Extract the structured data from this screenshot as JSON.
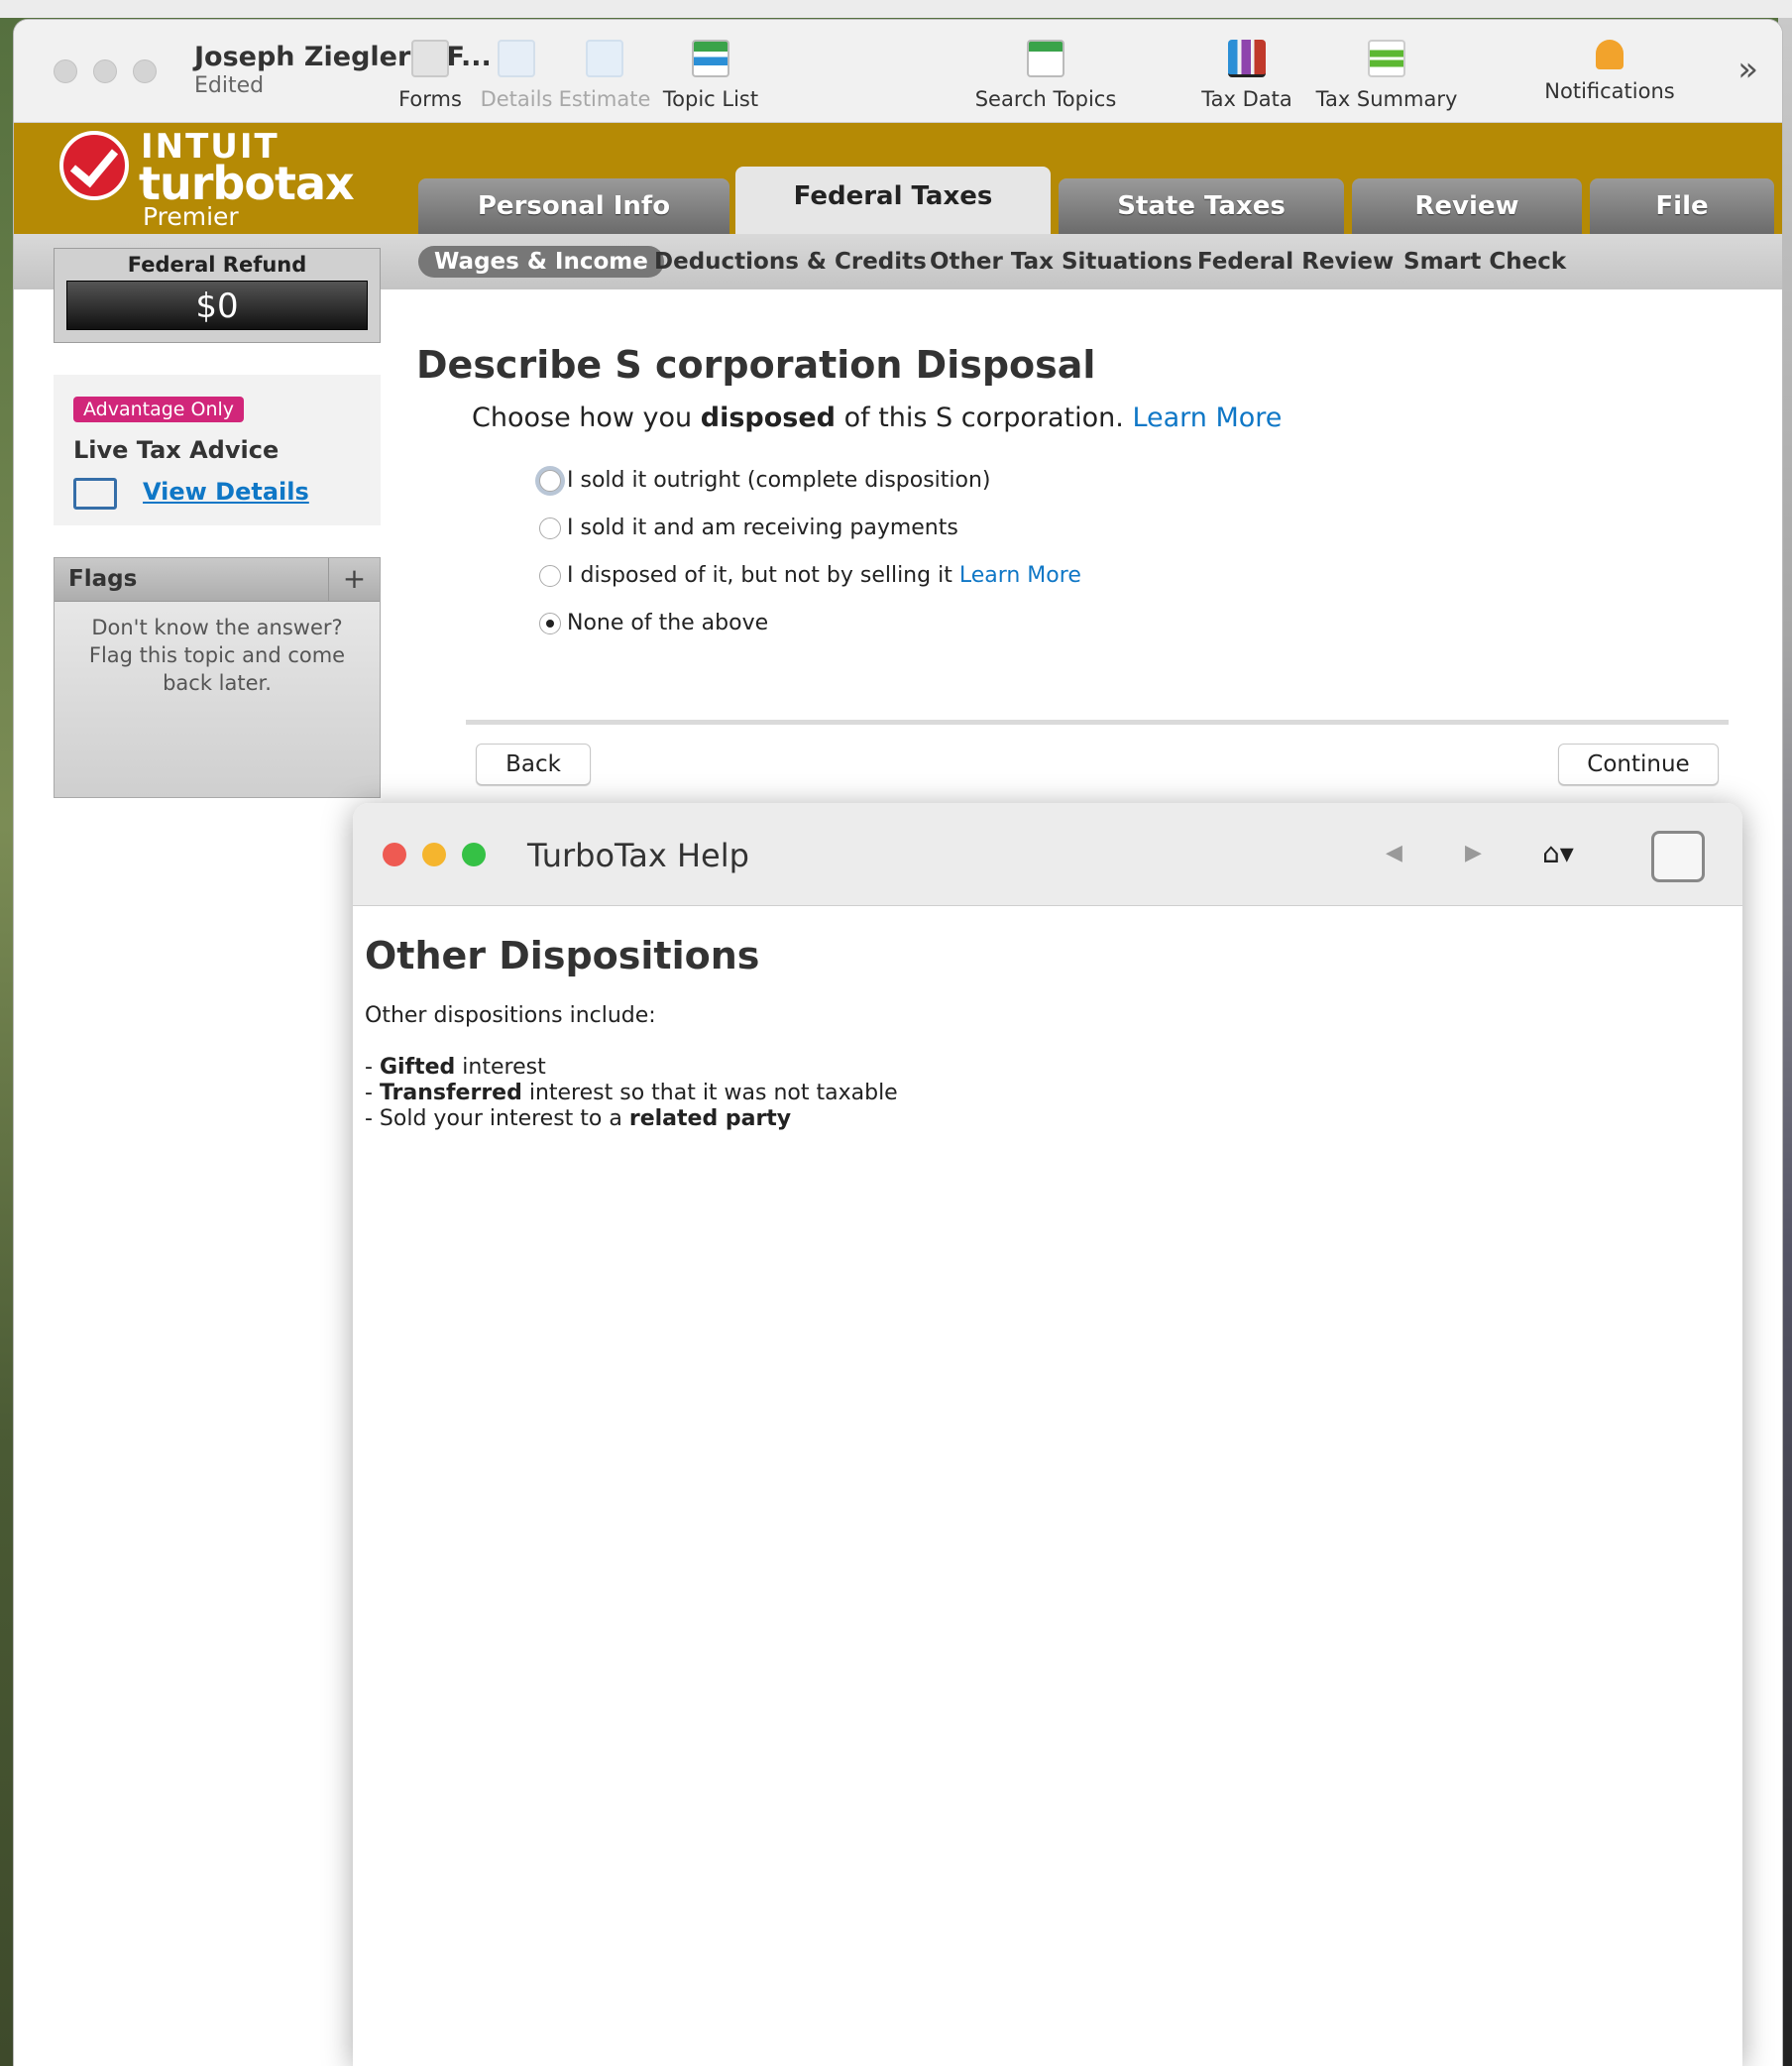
{
  "window": {
    "title": "Joseph Ziegler MF...",
    "subtitle": "Edited"
  },
  "toolbar": [
    {
      "label": "Forms",
      "icon": "forms-icon",
      "enabled": true
    },
    {
      "label": "Details",
      "icon": "details-icon",
      "enabled": false
    },
    {
      "label": "Estimate",
      "icon": "estimate-icon",
      "enabled": false
    },
    {
      "label": "Topic List",
      "icon": "topic-list-icon",
      "enabled": true
    },
    {
      "label": "Search Topics",
      "icon": "search-topics-icon",
      "enabled": true
    },
    {
      "label": "Tax Data",
      "icon": "bar-chart-icon",
      "enabled": true
    },
    {
      "label": "Tax Summary",
      "icon": "tax-summary-icon",
      "enabled": true
    },
    {
      "label": "Notifications",
      "icon": "bell-icon",
      "enabled": true
    }
  ],
  "brand": {
    "line1": "INTUIT",
    "line2": "turbotax",
    "line3": "Premier",
    "color": "#b58a05"
  },
  "main_tabs": [
    {
      "label": "Personal Info",
      "active": false
    },
    {
      "label": "Federal Taxes",
      "active": true
    },
    {
      "label": "State Taxes",
      "active": false
    },
    {
      "label": "Review",
      "active": false
    },
    {
      "label": "File",
      "active": false
    }
  ],
  "sub_tabs": [
    {
      "label": "Wages & Income",
      "active": true
    },
    {
      "label": "Deductions & Credits",
      "active": false
    },
    {
      "label": "Other Tax Situations",
      "active": false
    },
    {
      "label": "Federal Review",
      "active": false
    },
    {
      "label": "Smart Check",
      "active": false
    }
  ],
  "refund": {
    "label": "Federal Refund",
    "amount": "$0"
  },
  "advice": {
    "badge": "Advantage Only",
    "heading": "Live Tax Advice",
    "link": "View Details"
  },
  "flags": {
    "title": "Flags",
    "add": "+",
    "message": "Don't know the answer? Flag this topic and come back later."
  },
  "page": {
    "title": "Describe S corporation Disposal",
    "prompt_before": "Choose how you ",
    "prompt_bold": "disposed",
    "prompt_after": " of this S corporation. ",
    "prompt_link": "Learn More",
    "options": [
      {
        "label": "I sold it outright (complete disposition)",
        "selected": false,
        "link": ""
      },
      {
        "label": "I sold it and am receiving payments",
        "selected": false,
        "link": ""
      },
      {
        "label": "I disposed of it, but not by selling it ",
        "selected": false,
        "link": "Learn More"
      },
      {
        "label": "None of the above",
        "selected": true,
        "link": ""
      }
    ],
    "back": "Back",
    "continue": "Continue"
  },
  "help": {
    "window_title": "TurboTax Help",
    "heading": "Other Dispositions",
    "intro": "Other dispositions include:",
    "items": [
      {
        "prefix": "- ",
        "bold": "Gifted",
        "rest": " interest",
        "bold_end": ""
      },
      {
        "prefix": "- ",
        "bold": "Transferred",
        "rest": " interest so that it was not taxable",
        "bold_end": ""
      },
      {
        "prefix": "- Sold your interest to a ",
        "bold": "",
        "rest": "",
        "bold_end": "related party"
      }
    ]
  }
}
